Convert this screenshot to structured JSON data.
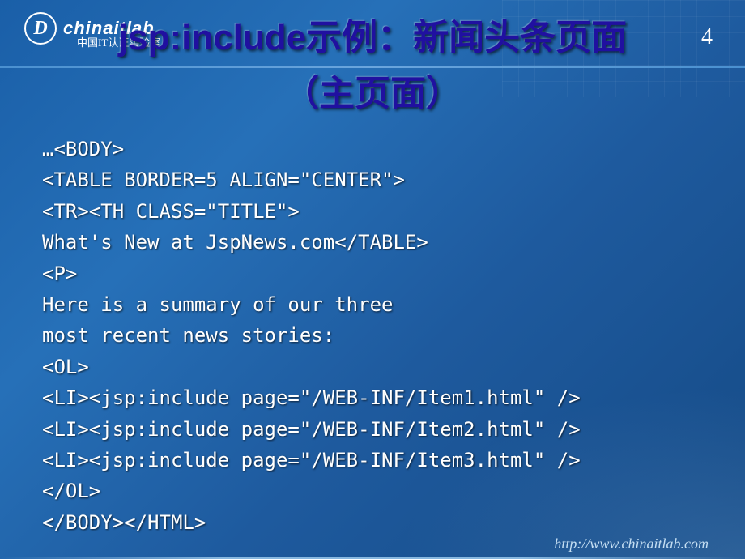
{
  "logo": {
    "icon": "D",
    "text": "chinaitlab",
    "subtitle": "中国IT认证实验室"
  },
  "pageNumber": "4",
  "title": {
    "line1": "jsp:include示例：新闻头条页面",
    "line2": "（主页面）"
  },
  "code": {
    "l1": "…<BODY>",
    "l2": "<TABLE BORDER=5 ALIGN=\"CENTER\">",
    "l3": "<TR><TH CLASS=\"TITLE\">",
    "l4": "What's New at JspNews.com</TABLE>",
    "l5": "<P>",
    "l6": "Here is a summary of our three",
    "l7": "most recent news stories:",
    "l8": "<OL>",
    "l9": "<LI><jsp:include page=\"/WEB-INF/Item1.html\" />",
    "l10": "<LI><jsp:include page=\"/WEB-INF/Item2.html\" />",
    "l11": "<LI><jsp:include page=\"/WEB-INF/Item3.html\" />",
    "l12": "</OL>",
    "l13": "</BODY></HTML>"
  },
  "footer": {
    "url": "http://www.chinaitlab.com"
  }
}
